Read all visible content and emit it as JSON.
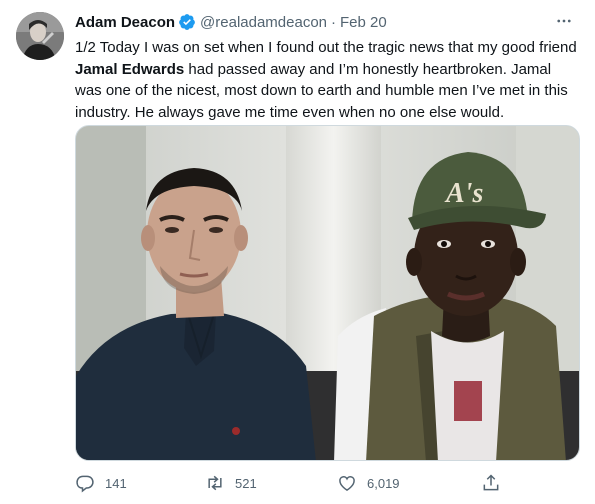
{
  "tweet": {
    "author_name": "Adam Deacon",
    "handle": "@realadamdeacon",
    "separator": "·",
    "date": "Feb 20",
    "text_part1": "1/2 Today I was on set when I found out the tragic news that my good friend ",
    "text_mention": "Jamal Edwards",
    "text_part2": " had passed away and I’m honestly heartbroken. Jamal was one of the nicest, most down to earth and humble men I’ve met in this industry. He always gave me time even when no one else would.",
    "cap_text": "A's",
    "metrics": {
      "replies": "141",
      "retweets": "521",
      "likes": "6,019"
    }
  },
  "colors": {
    "verified_blue": "#1d9bf0",
    "muted_text": "#536471",
    "primary_text": "#0f1419"
  },
  "icons": {
    "more": "more-dots-icon",
    "reply": "reply-icon",
    "retweet": "retweet-icon",
    "like": "like-icon",
    "share": "share-icon",
    "verified": "verified-badge-icon"
  }
}
